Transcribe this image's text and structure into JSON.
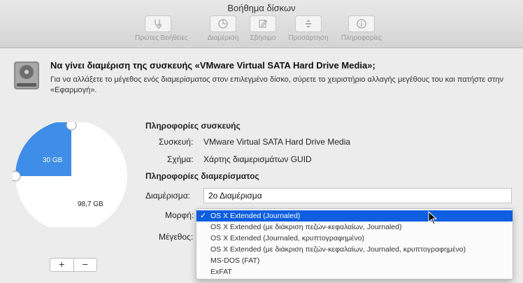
{
  "window": {
    "title": "Βοήθημα δίσκων"
  },
  "toolbar": {
    "items": [
      {
        "label": "Πρώτες Βοήθειες",
        "icon": "stethoscope-icon"
      },
      {
        "label": "Διαμέριση",
        "icon": "pie-chart-icon"
      },
      {
        "label": "Σβήσιμο",
        "icon": "erase-icon"
      },
      {
        "label": "Προσάρτηση",
        "icon": "mount-icon"
      },
      {
        "label": "Πληροφορίες",
        "icon": "info-icon"
      }
    ]
  },
  "dialog": {
    "heading": "Να γίνει διαμέριση της συσκευής «VMware Virtual SATA Hard Drive Media»;",
    "description": "Για να αλλάξετε το μέγεθος ενός διαμερίσματος στον επιλεγμένο δίσκο, σύρετε το χειριστήριο αλλαγής μεγέθους του και πατήστε στην «Εφαρμογή»."
  },
  "pie": {
    "slices": [
      {
        "label": "30 GB",
        "size_gb": 30,
        "color": "#3e8de8",
        "selected": true
      },
      {
        "label": "98,7 GB",
        "size_gb": 98.7,
        "color": "#ffffff",
        "selected": false
      }
    ],
    "add_label": "+",
    "remove_label": "−"
  },
  "device_info": {
    "section_title": "Πληροφορίες συσκευής",
    "device_label": "Συσκευή:",
    "device_value": "VMware Virtual SATA Hard Drive Media",
    "scheme_label": "Σχήμα:",
    "scheme_value": "Χάρτης διαμερισμάτων GUID"
  },
  "partition_info": {
    "section_title": "Πληροφορίες διαμερίσματος",
    "partition_label": "Διαμέρισμα:",
    "partition_value": "2ο Διαμέρισμα",
    "format_label": "Μορφή:",
    "size_label": "Μέγεθος:"
  },
  "format_options": [
    {
      "label": "OS X Extended (Journaled)",
      "selected": true
    },
    {
      "label": "OS X Extended (με διάκριση πεζών-κεφαλαίων, Journaled)",
      "selected": false
    },
    {
      "label": "OS X Extended (Journaled, κρυπτογραφημένο)",
      "selected": false
    },
    {
      "label": "OS X Extended (με διάκριση πεζών-κεφαλαίων, Journaled, κρυπτογραφημένο)",
      "selected": false
    },
    {
      "label": "MS-DOS (FAT)",
      "selected": false
    },
    {
      "label": "ExFAT",
      "selected": false
    }
  ],
  "checkmark": "✓",
  "colors": {
    "selection": "#0d5ee0",
    "pie_selected": "#3e8de8"
  }
}
